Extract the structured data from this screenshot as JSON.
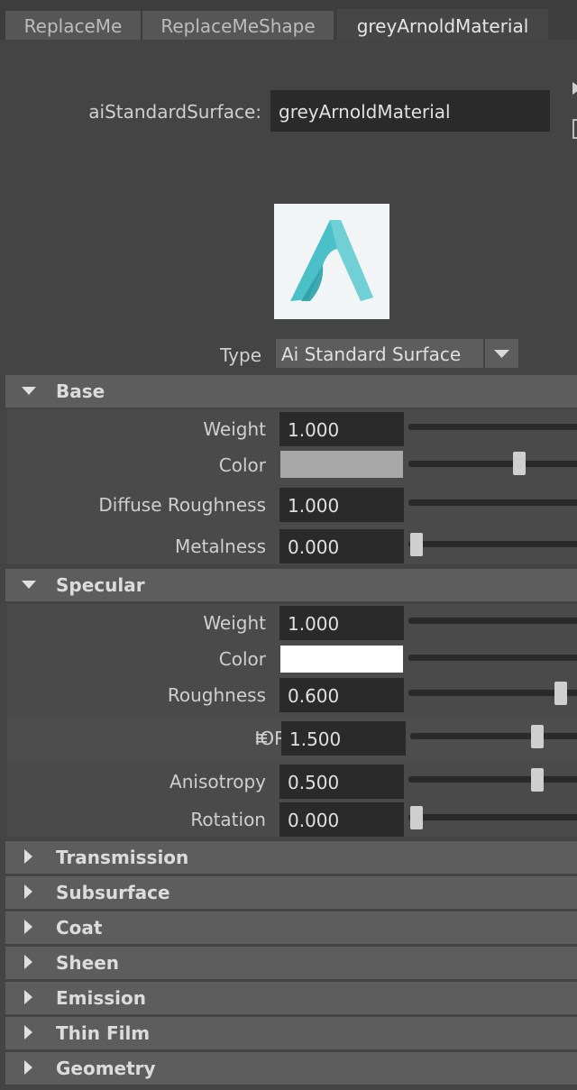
{
  "tabs": [
    {
      "label": "ReplaceMe",
      "active": false
    },
    {
      "label": "ReplaceMeShape",
      "active": false
    },
    {
      "label": "greyArnoldMaterial",
      "active": true
    }
  ],
  "header": {
    "node_type_label": "aiStandardSurface:",
    "node_name": "greyArnoldMaterial"
  },
  "type": {
    "label": "Type",
    "value": "Ai Standard Surface"
  },
  "sections": {
    "base": {
      "title": "Base",
      "expanded": true,
      "weight": {
        "label": "Weight",
        "value": "1.000"
      },
      "color": {
        "label": "Color",
        "swatch": "#a8a8a8",
        "slider": 0.6
      },
      "diffuse_roughness": {
        "label": "Diffuse Roughness",
        "value": "1.000"
      },
      "metalness": {
        "label": "Metalness",
        "value": "0.000",
        "slider": 0.0
      }
    },
    "specular": {
      "title": "Specular",
      "expanded": true,
      "weight": {
        "label": "Weight",
        "value": "1.000"
      },
      "color": {
        "label": "Color",
        "swatch": "#ffffff"
      },
      "roughness": {
        "label": "Roughness",
        "value": "0.600",
        "slider": 0.6
      },
      "ior": {
        "label": "IOR",
        "value": "1.500",
        "slider": 0.5
      },
      "anisotropy": {
        "label": "Anisotropy",
        "value": "0.500",
        "slider": 0.5
      },
      "rotation": {
        "label": "Rotation",
        "value": "0.000",
        "slider": 0.0
      }
    },
    "collapsed": [
      {
        "title": "Transmission"
      },
      {
        "title": "Subsurface"
      },
      {
        "title": "Coat"
      },
      {
        "title": "Sheen"
      },
      {
        "title": "Emission"
      },
      {
        "title": "Thin Film"
      },
      {
        "title": "Geometry"
      }
    ]
  },
  "colors": {
    "panel_bg": "#444444",
    "field_bg": "#2a2a2a",
    "section_header_bg": "#5d5d5d",
    "arnold_logo_teal": "#3fb8c2"
  },
  "icons": {
    "expanded": "triangle-down-icon",
    "collapsed": "triangle-right-icon",
    "ior_menu": "hamburger-menu-icon"
  }
}
